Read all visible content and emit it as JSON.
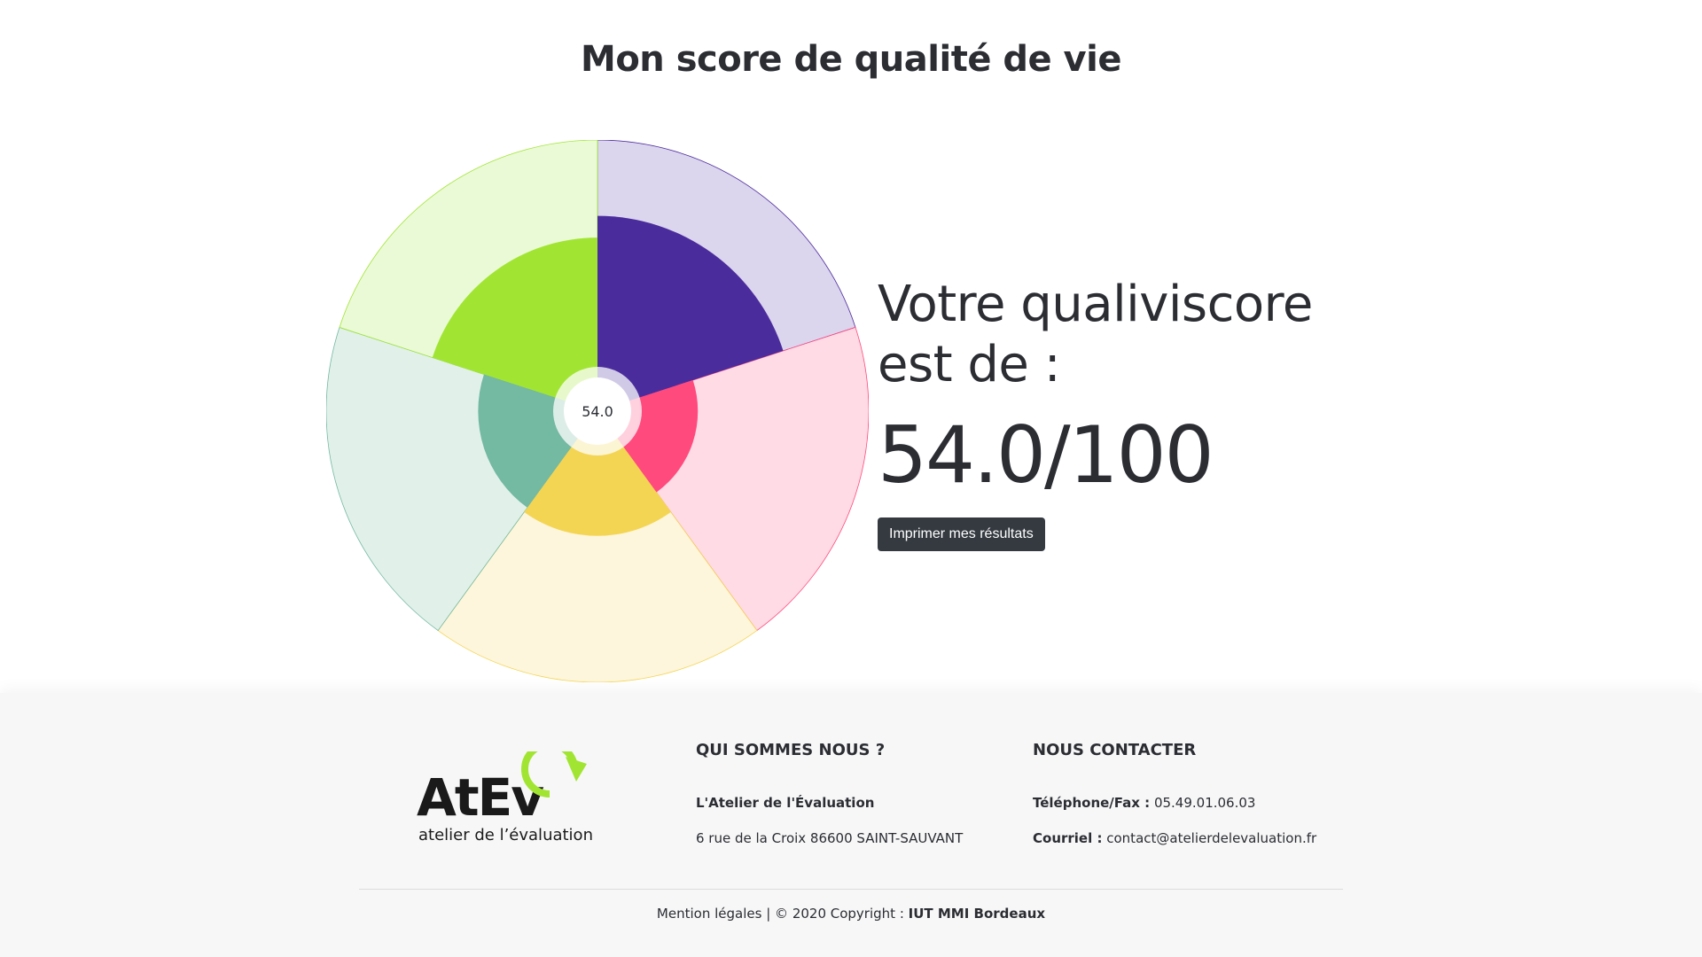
{
  "header": {
    "title": "Mon score de qualité de vie"
  },
  "chart_data": {
    "type": "polarArea",
    "center_label": "54.0",
    "r_max": 100,
    "series": [
      {
        "value": 72,
        "color": "#4a2c9c",
        "bg": "#dcd5ee"
      },
      {
        "value": 37,
        "color": "#ff4a7d",
        "bg": "#ffdbe5"
      },
      {
        "value": 46,
        "color": "#f4d553",
        "bg": "#fdf6dc"
      },
      {
        "value": 44,
        "color": "#74b9a2",
        "bg": "#e1f1ea"
      },
      {
        "value": 64,
        "color": "#a1e532",
        "bg": "#eafad7"
      }
    ]
  },
  "score": {
    "label": "Votre qualiviscore est de :",
    "value": "54.0/100",
    "print_label": "Imprimer mes résultats"
  },
  "footer": {
    "logo_text": "AtEv",
    "logo_tagline": "atelier de l’évaluation",
    "logo_color": "#a1e532",
    "about": {
      "title": "QUI SOMMES NOUS ?",
      "name": "L'Atelier de l'Évaluation",
      "address": "6 rue de la Croix 86600 SAINT-SAUVANT"
    },
    "contact": {
      "title": "NOUS CONTACTER",
      "phone_label": "Téléphone/Fax :",
      "phone": "05.49.01.06.03",
      "email_label": "Courriel :",
      "email": "contact@atelierdelevaluation.fr"
    },
    "legal_link": "Mention légales",
    "separator": "|",
    "copyright": "© 2020 Copyright :",
    "copyright_owner": "IUT MMI Bordeaux"
  }
}
